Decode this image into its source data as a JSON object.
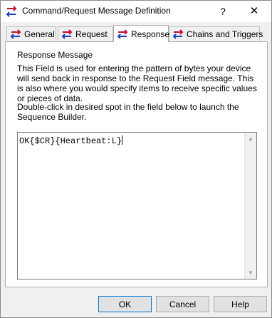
{
  "window": {
    "title": "Command/Request Message Definition",
    "help_glyph": "?",
    "close_glyph": "✕"
  },
  "tabs": [
    {
      "label": "General",
      "icon": "double-arrow-icon",
      "active": false
    },
    {
      "label": "Request",
      "icon": "double-arrow-icon",
      "active": false
    },
    {
      "label": "Response",
      "icon": "double-arrow-icon",
      "active": true
    },
    {
      "label": "Chains and Triggers",
      "icon": "double-arrow-icon",
      "active": false
    }
  ],
  "panel": {
    "heading": "Response Message",
    "description": "This Field is used for entering the pattern of bytes your device will send back in response to the Request Field message.  This is also where you would specify items to receive specific values or pieces of data.",
    "hint": "Double-click in desired spot in the field below to launch the Sequence Builder.",
    "field_value": "OK{$CR}{Heartbeat:L}"
  },
  "buttons": {
    "ok": "OK",
    "cancel": "Cancel",
    "help": "Help"
  },
  "colors": {
    "icon_red": "#c8102e",
    "icon_blue": "#1f3fbf",
    "focus_blue": "#0078d7"
  }
}
